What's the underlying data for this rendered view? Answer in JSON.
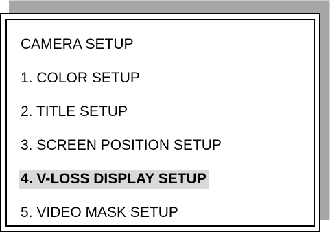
{
  "menu": {
    "title": "CAMERA SETUP",
    "items": [
      {
        "label": "1. COLOR SETUP",
        "selected": false
      },
      {
        "label": "2. TITLE SETUP",
        "selected": false
      },
      {
        "label": "3. SCREEN POSITION SETUP",
        "selected": false
      },
      {
        "label": "4. V-LOSS DISPLAY SETUP",
        "selected": true
      },
      {
        "label": "5. VIDEO MASK SETUP",
        "selected": false
      }
    ]
  },
  "colors": {
    "border": "#000000",
    "shadow": "#a6a6a6",
    "highlight": "#d9d9d9",
    "background": "#ffffff"
  }
}
